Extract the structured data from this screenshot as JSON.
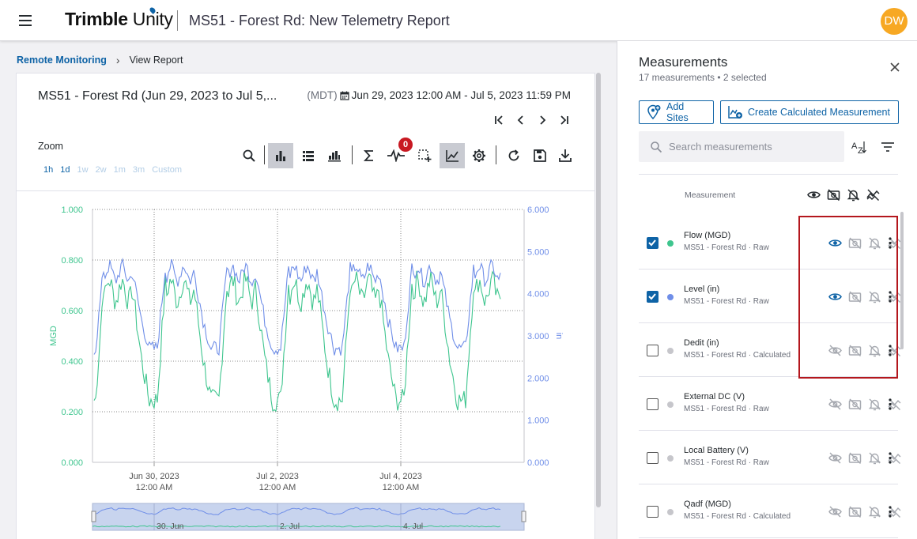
{
  "header": {
    "logo_bold": "Trimble",
    "logo_light": " Unity",
    "page_title": "MS51 - Forest Rd: New Telemetry Report",
    "user_initials": "DW"
  },
  "breadcrumb": {
    "parent": "Remote Monitoring",
    "current": "View Report"
  },
  "report": {
    "title": "MS51 - Forest Rd (Jun 29, 2023 to Jul 5,...",
    "timezone": "(MDT)",
    "date_range": "Jun 29, 2023 12:00 AM - Jul 5, 2023 11:59 PM",
    "zoom_label": "Zoom",
    "zoom_options": [
      "1h",
      "1d",
      "1w",
      "2w",
      "1m",
      "3m",
      "Custom"
    ],
    "alert_count": "0",
    "toolbar_icons": [
      "search-icon",
      "bar-chart-icon",
      "list-icon",
      "grouped-bar-icon",
      "sigma-icon",
      "event-icon",
      "select-add-icon",
      "line-chart-icon",
      "gear-icon",
      "refresh-icon",
      "save-icon",
      "download-icon"
    ]
  },
  "chart_data": {
    "type": "line",
    "left_axis": {
      "label": "MGD",
      "ticks": [
        "1.000",
        "0.800",
        "0.600",
        "0.400",
        "0.200",
        "0.000"
      ],
      "ylim": [
        0,
        1
      ]
    },
    "right_axis": {
      "label": "in",
      "ticks": [
        "6.000",
        "5.000",
        "4.000",
        "3.000",
        "2.000",
        "1.000",
        "0.000"
      ],
      "ylim": [
        0,
        6
      ]
    },
    "x_ticks": [
      {
        "date": "Jun 30, 2023",
        "time": "12:00 AM"
      },
      {
        "date": "Jul 2, 2023",
        "time": "12:00 AM"
      },
      {
        "date": "Jul 4, 2023",
        "time": "12:00 AM"
      }
    ],
    "x_range": [
      "Jun 29, 2023 12:00 AM",
      "Jul 5, 2023 11:59 PM"
    ],
    "series": [
      {
        "name": "Flow (MGD)",
        "axis": "left",
        "color": "#3ec58e",
        "daily_pattern": {
          "min": 0.22,
          "max": 0.73
        }
      },
      {
        "name": "Level (in)",
        "axis": "right",
        "color": "#6f8ee8",
        "daily_pattern": {
          "min": 2.6,
          "max": 4.7
        }
      }
    ],
    "grid": true,
    "navigator_labels": [
      "30. Jun",
      "2. Jul",
      "4. Jul"
    ]
  },
  "panel": {
    "title": "Measurements",
    "subtitle": "17 measurements • 2 selected",
    "add_sites": "Add Sites",
    "create_calc": "Create Calculated Measurement",
    "search_placeholder": "Search measurements",
    "column_measurement": "Measurement",
    "rows": [
      {
        "name": "Flow (MGD)",
        "sub": "MS51 - Forest Rd · Raw",
        "checked": true,
        "color": "#3ec58e",
        "visible": true
      },
      {
        "name": "Level (in)",
        "sub": "MS51 - Forest Rd · Raw",
        "checked": true,
        "color": "#6f8ee8",
        "visible": true
      },
      {
        "name": "Dedit (in)",
        "sub": "MS51 - Forest Rd · Calculated",
        "checked": false,
        "color": "#c6c6cb",
        "visible": false
      },
      {
        "name": "External DC (V)",
        "sub": "MS51 - Forest Rd · Raw",
        "checked": false,
        "color": "#c6c6cb",
        "visible": false
      },
      {
        "name": "Local Battery (V)",
        "sub": "MS51 - Forest Rd · Raw",
        "checked": false,
        "color": "#c6c6cb",
        "visible": false
      },
      {
        "name": "Qadf (MGD)",
        "sub": "MS51 - Forest Rd · Calculated",
        "checked": false,
        "color": "#c6c6cb",
        "visible": false
      }
    ]
  },
  "colors": {
    "brand_blue": "#0e63a6",
    "flow_green": "#3ec58e",
    "level_blue": "#6f8ee8",
    "avatar": "#f7a823",
    "highlight": "#b4171d"
  }
}
